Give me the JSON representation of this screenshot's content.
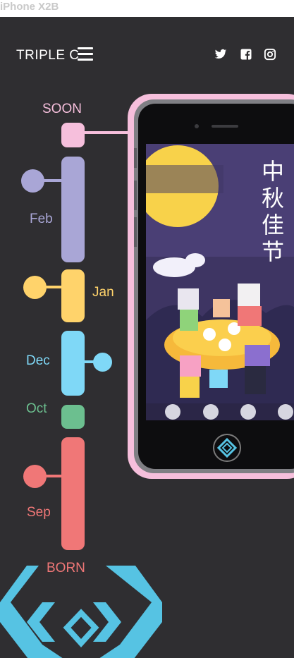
{
  "frame_label": "iPhone X2B",
  "header": {
    "brand": "TRIPLE C",
    "social_icons": [
      "twitter-icon",
      "facebook-icon",
      "instagram-icon"
    ]
  },
  "timeline": {
    "top_label": "SOON",
    "bottom_label": "BORN",
    "months": [
      {
        "label": "Feb",
        "color": "#a9a6d6"
      },
      {
        "label": "Jan",
        "color": "#ffd36b"
      },
      {
        "label": "Dec",
        "color": "#7fd8f7"
      },
      {
        "label": "Oct",
        "color": "#6cbf8f"
      },
      {
        "label": "Sep",
        "color": "#f07777"
      }
    ],
    "colors": {
      "soon": "#f6bfdc",
      "born": "#f07777",
      "logo": "#56c3e3"
    }
  },
  "phone": {
    "poster_title": "中秋佳节",
    "frame_color": "#f6bfdc",
    "dock_icons": [
      "phone-icon",
      "cloud-icon",
      "user-icon",
      "wifi-icon"
    ]
  }
}
